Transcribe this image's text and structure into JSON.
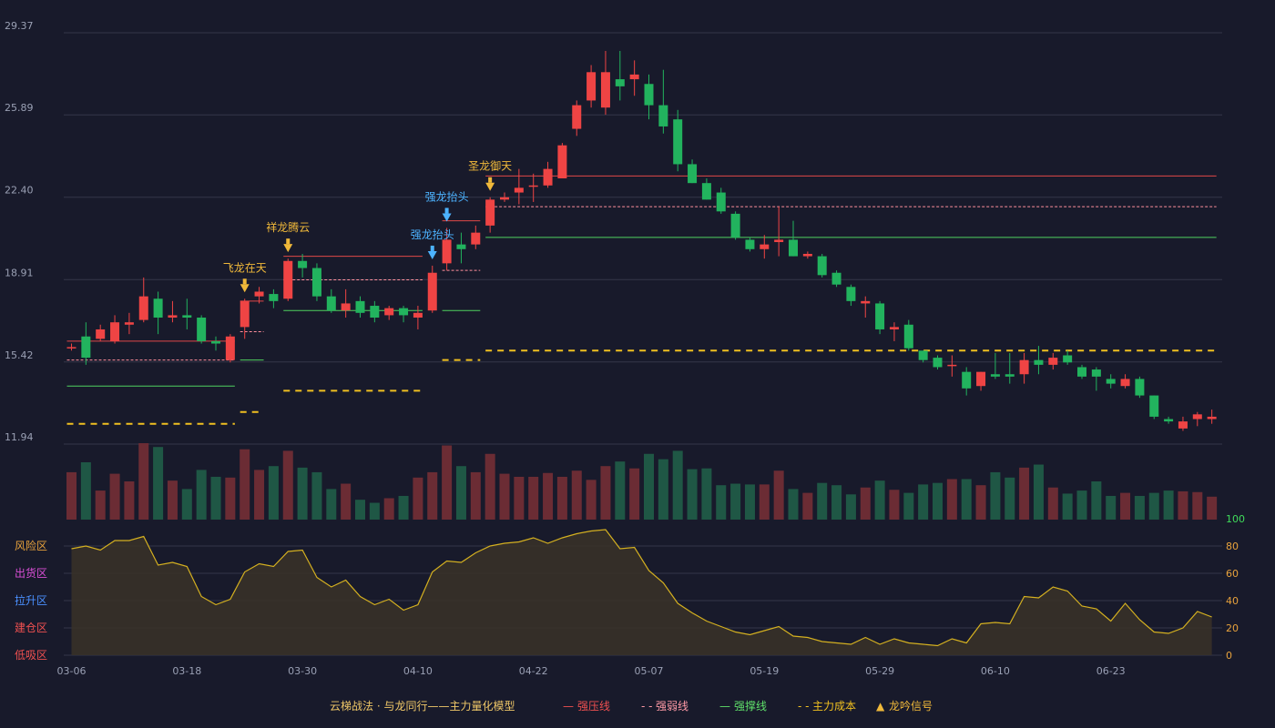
{
  "chart_data": {
    "type": "candlestick",
    "title": "",
    "price_axis": {
      "ylim": [
        11.94,
        29.37
      ],
      "ticks": [
        "29.37",
        "25.89",
        "22.40",
        "18.91",
        "15.42",
        "11.94"
      ]
    },
    "indicator_axis": {
      "ylim": [
        0,
        100
      ],
      "ticks": [
        "100",
        "80",
        "60",
        "40",
        "20",
        "0"
      ]
    },
    "x_ticks": [
      {
        "i": 0,
        "label": "03-06"
      },
      {
        "i": 8,
        "label": "03-18"
      },
      {
        "i": 16,
        "label": "03-30"
      },
      {
        "i": 24,
        "label": "04-10"
      },
      {
        "i": 32,
        "label": "04-22"
      },
      {
        "i": 40,
        "label": "05-07"
      },
      {
        "i": 48,
        "label": "05-19"
      },
      {
        "i": 56,
        "label": "05-29"
      },
      {
        "i": 64,
        "label": "06-10"
      },
      {
        "i": 72,
        "label": "06-23"
      }
    ],
    "zone_labels": [
      {
        "text": "风险区",
        "value": 80,
        "color": "#e8a23c"
      },
      {
        "text": "出货区",
        "value": 60,
        "color": "#d94fd6"
      },
      {
        "text": "拉升区",
        "value": 40,
        "color": "#4a90ff"
      },
      {
        "text": "建仓区",
        "value": 20,
        "color": "#f05050"
      },
      {
        "text": "低吸区",
        "value": 0,
        "color": "#f05050"
      }
    ],
    "candles": [
      [
        16.0,
        16.05,
        15.9,
        16.2
      ],
      [
        16.5,
        15.6,
        15.3,
        17.1
      ],
      [
        16.4,
        16.8,
        16.3,
        17.0
      ],
      [
        16.3,
        17.1,
        16.2,
        17.4
      ],
      [
        17.0,
        17.1,
        16.6,
        17.5
      ],
      [
        17.2,
        18.2,
        17.1,
        19.0
      ],
      [
        18.1,
        17.3,
        16.6,
        18.4
      ],
      [
        17.3,
        17.4,
        17.1,
        18.0
      ],
      [
        17.4,
        17.3,
        16.8,
        18.1
      ],
      [
        17.3,
        16.3,
        16.2,
        17.4
      ],
      [
        16.3,
        16.2,
        15.9,
        16.5
      ],
      [
        15.5,
        16.5,
        15.4,
        16.6
      ],
      [
        16.9,
        18.0,
        16.4,
        18.1
      ],
      [
        18.2,
        18.4,
        17.9,
        18.6
      ],
      [
        18.3,
        18.0,
        17.7,
        18.5
      ],
      [
        18.1,
        19.7,
        18.0,
        19.8
      ],
      [
        19.7,
        19.4,
        19.0,
        20.0
      ],
      [
        19.4,
        18.2,
        18.0,
        19.6
      ],
      [
        18.2,
        17.6,
        17.5,
        18.5
      ],
      [
        17.6,
        17.9,
        17.3,
        18.5
      ],
      [
        18.0,
        17.5,
        17.3,
        18.2
      ],
      [
        17.8,
        17.3,
        17.1,
        18.0
      ],
      [
        17.4,
        17.7,
        17.2,
        17.8
      ],
      [
        17.7,
        17.4,
        17.1,
        17.8
      ],
      [
        17.3,
        17.5,
        16.8,
        17.8
      ],
      [
        17.6,
        19.2,
        17.5,
        19.5
      ],
      [
        19.6,
        20.6,
        19.3,
        21.1
      ],
      [
        20.4,
        20.2,
        19.6,
        20.9
      ],
      [
        20.4,
        20.9,
        20.2,
        21.2
      ],
      [
        21.2,
        22.3,
        20.9,
        22.4
      ],
      [
        22.3,
        22.4,
        22.2,
        22.6
      ],
      [
        22.6,
        22.8,
        22.1,
        23.6
      ],
      [
        22.9,
        22.9,
        22.2,
        23.4
      ],
      [
        22.9,
        23.6,
        22.8,
        23.9
      ],
      [
        23.2,
        24.6,
        23.2,
        24.7
      ],
      [
        25.3,
        26.3,
        25.0,
        26.5
      ],
      [
        26.5,
        27.7,
        26.2,
        28.0
      ],
      [
        26.2,
        27.7,
        25.9,
        28.6
      ],
      [
        27.4,
        27.1,
        26.5,
        28.6
      ],
      [
        27.4,
        27.6,
        26.7,
        28.2
      ],
      [
        27.2,
        26.3,
        25.7,
        27.6
      ],
      [
        26.3,
        25.4,
        25.1,
        27.8
      ],
      [
        25.7,
        23.8,
        23.5,
        26.1
      ],
      [
        23.8,
        23.0,
        23.0,
        24.0
      ],
      [
        23.0,
        22.3,
        22.3,
        23.2
      ],
      [
        22.6,
        21.8,
        21.7,
        22.8
      ],
      [
        21.7,
        20.7,
        20.6,
        21.8
      ],
      [
        20.6,
        20.2,
        20.1,
        20.7
      ],
      [
        20.2,
        20.4,
        19.8,
        20.8
      ],
      [
        20.5,
        20.6,
        19.9,
        22.0
      ],
      [
        20.6,
        19.9,
        19.9,
        21.4
      ],
      [
        19.9,
        20.0,
        19.8,
        20.1
      ],
      [
        19.9,
        19.1,
        19.0,
        20.0
      ],
      [
        19.2,
        18.7,
        18.6,
        19.3
      ],
      [
        18.6,
        18.0,
        17.8,
        18.7
      ],
      [
        17.9,
        18.0,
        17.3,
        18.2
      ],
      [
        17.9,
        16.8,
        16.6,
        18.0
      ],
      [
        16.8,
        16.9,
        16.3,
        17.1
      ],
      [
        17.0,
        16.0,
        15.9,
        17.2
      ],
      [
        15.9,
        15.5,
        15.4,
        15.9
      ],
      [
        15.6,
        15.2,
        15.1,
        15.7
      ],
      [
        15.3,
        15.3,
        14.8,
        15.7
      ],
      [
        15.0,
        14.3,
        14.0,
        15.2
      ],
      [
        14.4,
        15.0,
        14.2,
        15.0
      ],
      [
        14.9,
        14.8,
        14.7,
        15.8
      ],
      [
        14.9,
        14.8,
        14.5,
        15.8
      ],
      [
        14.9,
        15.5,
        14.5,
        15.8
      ],
      [
        15.5,
        15.3,
        14.9,
        16.1
      ],
      [
        15.3,
        15.6,
        15.1,
        15.8
      ],
      [
        15.7,
        15.4,
        15.3,
        15.9
      ],
      [
        15.2,
        14.8,
        14.7,
        15.3
      ],
      [
        15.1,
        14.8,
        14.2,
        15.2
      ],
      [
        14.7,
        14.5,
        14.3,
        14.9
      ],
      [
        14.4,
        14.7,
        14.3,
        14.9
      ],
      [
        14.7,
        14.0,
        13.9,
        14.8
      ],
      [
        14.0,
        13.1,
        13.0,
        14.0
      ],
      [
        13.0,
        12.9,
        12.8,
        13.1
      ],
      [
        12.6,
        12.9,
        12.5,
        13.1
      ],
      [
        13.0,
        13.2,
        12.7,
        13.3
      ],
      [
        13.0,
        13.1,
        12.8,
        13.4
      ]
    ],
    "volume_levels": [
      0.62,
      0.75,
      0.38,
      0.6,
      0.5,
      1.0,
      0.95,
      0.51,
      0.4,
      0.65,
      0.56,
      0.55,
      0.92,
      0.65,
      0.7,
      0.9,
      0.68,
      0.62,
      0.4,
      0.47,
      0.26,
      0.22,
      0.28,
      0.31,
      0.55,
      0.62,
      0.97,
      0.7,
      0.62,
      0.86,
      0.6,
      0.56,
      0.56,
      0.61,
      0.56,
      0.64,
      0.52,
      0.7,
      0.76,
      0.67,
      0.86,
      0.79,
      0.9,
      0.66,
      0.67,
      0.45,
      0.47,
      0.46,
      0.46,
      0.64,
      0.4,
      0.35,
      0.48,
      0.45,
      0.33,
      0.42,
      0.51,
      0.39,
      0.35,
      0.46,
      0.48,
      0.53,
      0.53,
      0.45,
      0.62,
      0.55,
      0.68,
      0.72,
      0.42,
      0.34,
      0.38,
      0.5,
      0.31,
      0.35,
      0.31,
      0.35,
      0.38,
      0.37,
      0.36,
      0.3
    ],
    "indicator": [
      78,
      80,
      77,
      84,
      84,
      87,
      66,
      68,
      65,
      43,
      37,
      41,
      61,
      67,
      65,
      76,
      77,
      57,
      50,
      55,
      43,
      37,
      41,
      33,
      37,
      61,
      69,
      68,
      75,
      80,
      82,
      83,
      86,
      82,
      86,
      89,
      91,
      92,
      78,
      79,
      62,
      53,
      38,
      31,
      25,
      21,
      17,
      15,
      18,
      21,
      14,
      13,
      10,
      9,
      8,
      13,
      8,
      12,
      9,
      8,
      7,
      12,
      9,
      23,
      24,
      23,
      43,
      42,
      50,
      47,
      36,
      34,
      25,
      38,
      26,
      17,
      16,
      20,
      32,
      28
    ],
    "lines": [
      {
        "kind": "strong_pressure",
        "y": 16.3,
        "from": 0,
        "to": 11
      },
      {
        "kind": "strong_weak",
        "y": 15.5,
        "from": 0,
        "to": 11
      },
      {
        "kind": "strong_support",
        "y": 14.4,
        "from": 0,
        "to": 11
      },
      {
        "kind": "main_cost",
        "y": 12.8,
        "from": 0,
        "to": 11
      },
      {
        "kind": "strong_pressure",
        "y": 18.0,
        "from": 12,
        "to": 13
      },
      {
        "kind": "strong_weak",
        "y": 16.7,
        "from": 12,
        "to": 13
      },
      {
        "kind": "strong_support",
        "y": 15.5,
        "from": 12,
        "to": 13
      },
      {
        "kind": "main_cost",
        "y": 13.3,
        "from": 12,
        "to": 13
      },
      {
        "kind": "strong_pressure",
        "y": 19.9,
        "from": 15,
        "to": 24
      },
      {
        "kind": "strong_weak",
        "y": 18.9,
        "from": 15,
        "to": 24
      },
      {
        "kind": "strong_support",
        "y": 17.6,
        "from": 15,
        "to": 24
      },
      {
        "kind": "main_cost",
        "y": 14.2,
        "from": 15,
        "to": 24
      },
      {
        "kind": "strong_pressure",
        "y": 21.4,
        "from": 26,
        "to": 28
      },
      {
        "kind": "strong_weak",
        "y": 19.3,
        "from": 26,
        "to": 28
      },
      {
        "kind": "strong_support",
        "y": 17.6,
        "from": 26,
        "to": 28
      },
      {
        "kind": "main_cost",
        "y": 15.5,
        "from": 26,
        "to": 28
      },
      {
        "kind": "strong_pressure",
        "y": 23.3,
        "from": 29,
        "to": 79
      },
      {
        "kind": "strong_weak",
        "y": 22.0,
        "from": 29,
        "to": 79
      },
      {
        "kind": "strong_support",
        "y": 20.7,
        "from": 29,
        "to": 79
      },
      {
        "kind": "main_cost",
        "y": 15.9,
        "from": 29,
        "to": 79
      }
    ],
    "signals": [
      {
        "i": 12,
        "label": "飞龙在天",
        "color": "#f0b93a",
        "dy": 0
      },
      {
        "i": 15,
        "label": "祥龙腾云",
        "color": "#f0b93a",
        "dy": 0
      },
      {
        "i": 25,
        "label": "强龙抬头",
        "color": "#4cb3ff",
        "dy": 0
      },
      {
        "i": 26,
        "label": "强龙抬头",
        "color": "#4cb3ff",
        "dy": 0
      },
      {
        "i": 29,
        "label": "圣龙御天",
        "color": "#f0b93a",
        "dy": 0
      }
    ],
    "legend": {
      "title": "云梯战法 · 与龙同行——主力量化模型",
      "items": [
        {
          "label": "强压线",
          "color": "#f05050",
          "style": "solid",
          "symbol": "—"
        },
        {
          "label": "强弱线",
          "color": "#ff9aa6",
          "style": "dashed",
          "symbol": "- -"
        },
        {
          "label": "强撑线",
          "color": "#5fe06a",
          "style": "solid",
          "symbol": "—"
        },
        {
          "label": "主力成本",
          "color": "#f0c020",
          "style": "dashed",
          "symbol": "- -"
        },
        {
          "label": "龙吟信号",
          "color": "#f0b93a",
          "style": "marker",
          "symbol": "▲"
        }
      ]
    },
    "colors": {
      "up": "#ef4444",
      "down": "#22b35e",
      "up_volume": "#6b2c34",
      "down_volume": "#1f5745",
      "indicator": "#d4b020",
      "grid": "#34364a"
    }
  }
}
